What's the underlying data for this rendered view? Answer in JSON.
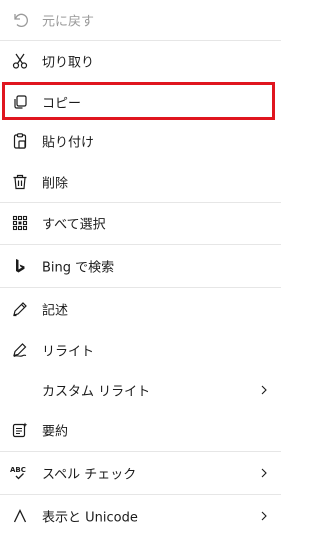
{
  "menu": {
    "items": [
      {
        "label": "元に戻す",
        "icon": "undo-icon",
        "enabled": false
      },
      {
        "label": "切り取り",
        "icon": "scissors-icon",
        "enabled": true
      },
      {
        "label": "コピー",
        "icon": "copy-icon",
        "enabled": true,
        "highlighted": true
      },
      {
        "label": "貼り付け",
        "icon": "clipboard-icon",
        "enabled": true
      },
      {
        "label": "削除",
        "icon": "trash-icon",
        "enabled": true
      },
      {
        "label": "すべて選択",
        "icon": "select-all-icon",
        "enabled": true
      },
      {
        "label": "Bing で検索",
        "icon": "bing-icon",
        "enabled": true
      },
      {
        "label": "記述",
        "icon": "pen-icon",
        "enabled": true
      },
      {
        "label": "リライト",
        "icon": "rewrite-icon",
        "enabled": true
      },
      {
        "label": "カスタム リライト",
        "icon": "",
        "enabled": true,
        "submenu": true
      },
      {
        "label": "要約",
        "icon": "summarize-icon",
        "enabled": true
      },
      {
        "label": "スペル チェック",
        "icon": "spellcheck-icon",
        "enabled": true,
        "submenu": true
      },
      {
        "label": "表示と Unicode",
        "icon": "unicode-caret-icon",
        "enabled": true,
        "submenu": true
      }
    ]
  },
  "colors": {
    "text": "#1b1b1b",
    "disabled_text": "#9a9a9a",
    "separator": "#e6e6e6",
    "highlight_border": "#e0161f"
  }
}
